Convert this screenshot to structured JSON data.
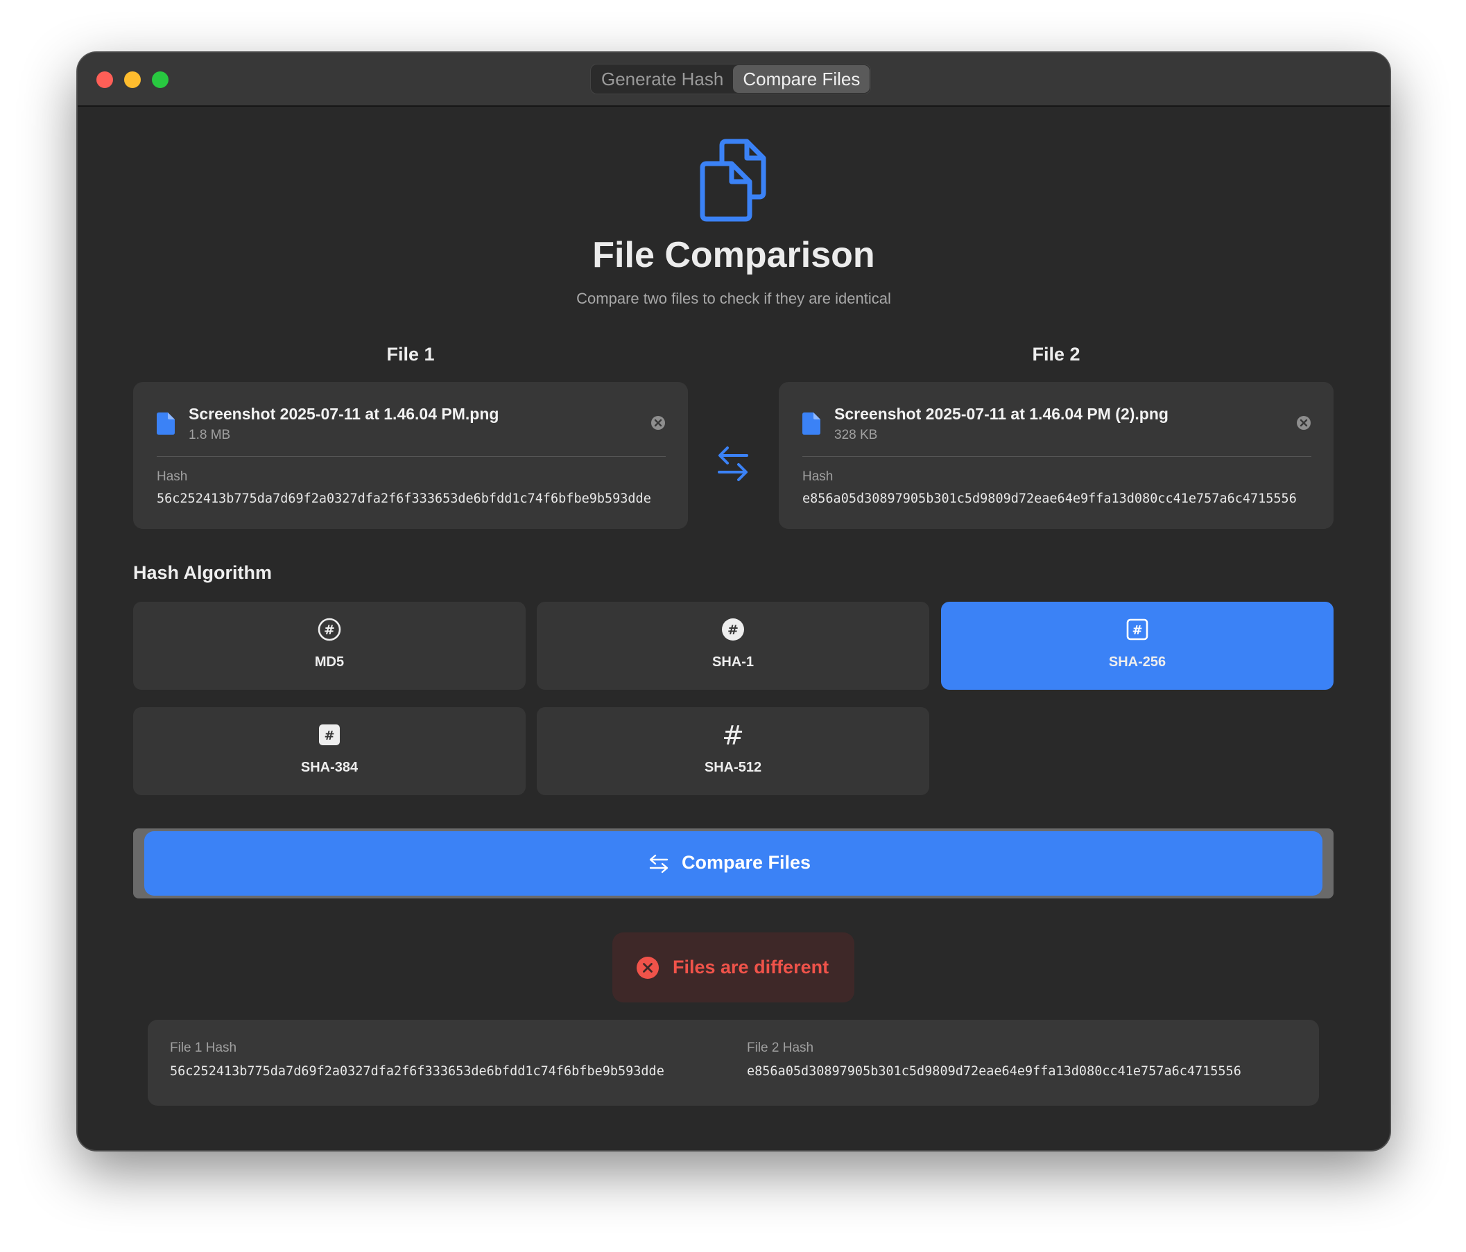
{
  "window": {
    "tabs": [
      {
        "label": "Generate Hash",
        "active": false
      },
      {
        "label": "Compare Files",
        "active": true
      }
    ]
  },
  "header": {
    "icon": "documents-icon",
    "title": "File Comparison",
    "subtitle": "Compare two files to check if they are identical"
  },
  "files": [
    {
      "label": "File 1",
      "name": "Screenshot 2025-07-11 at 1.46.04 PM.png",
      "size": "1.8 MB",
      "hash_label": "Hash",
      "hash": "56c252413b775da7d69f2a0327dfa2f6f333653de6bfdd1c74f6bfbe9b593dde"
    },
    {
      "label": "File 2",
      "name": "Screenshot 2025-07-11 at 1.46.04 PM (2).png",
      "size": "328 KB",
      "hash_label": "Hash",
      "hash": "e856a05d30897905b301c5d9809d72eae64e9ffa13d080cc41e757a6c4715556"
    }
  ],
  "algorithm": {
    "section_label": "Hash Algorithm",
    "options": [
      {
        "label": "MD5",
        "icon": "number-circle-outline-icon",
        "selected": false
      },
      {
        "label": "SHA-1",
        "icon": "number-circle-filled-icon",
        "selected": false
      },
      {
        "label": "SHA-256",
        "icon": "number-square-outline-icon",
        "selected": true
      },
      {
        "label": "SHA-384",
        "icon": "number-square-filled-icon",
        "selected": false
      },
      {
        "label": "SHA-512",
        "icon": "number-sign-icon",
        "selected": false
      }
    ]
  },
  "compare_button": {
    "label": "Compare Files",
    "icon": "arrows-swap-icon"
  },
  "result": {
    "label": "Files are different",
    "icon": "x-circle-icon",
    "status": "different"
  },
  "summary": {
    "file1_label": "File 1 Hash",
    "file1_hash": "56c252413b775da7d69f2a0327dfa2f6f333653de6bfdd1c74f6bfbe9b593dde",
    "file2_label": "File 2 Hash",
    "file2_hash": "e856a05d30897905b301c5d9809d72eae64e9ffa13d080cc41e757a6c4715556"
  },
  "colors": {
    "accent": "#3b82f6",
    "error": "#f0534a",
    "background": "#292929",
    "card": "#373737"
  }
}
